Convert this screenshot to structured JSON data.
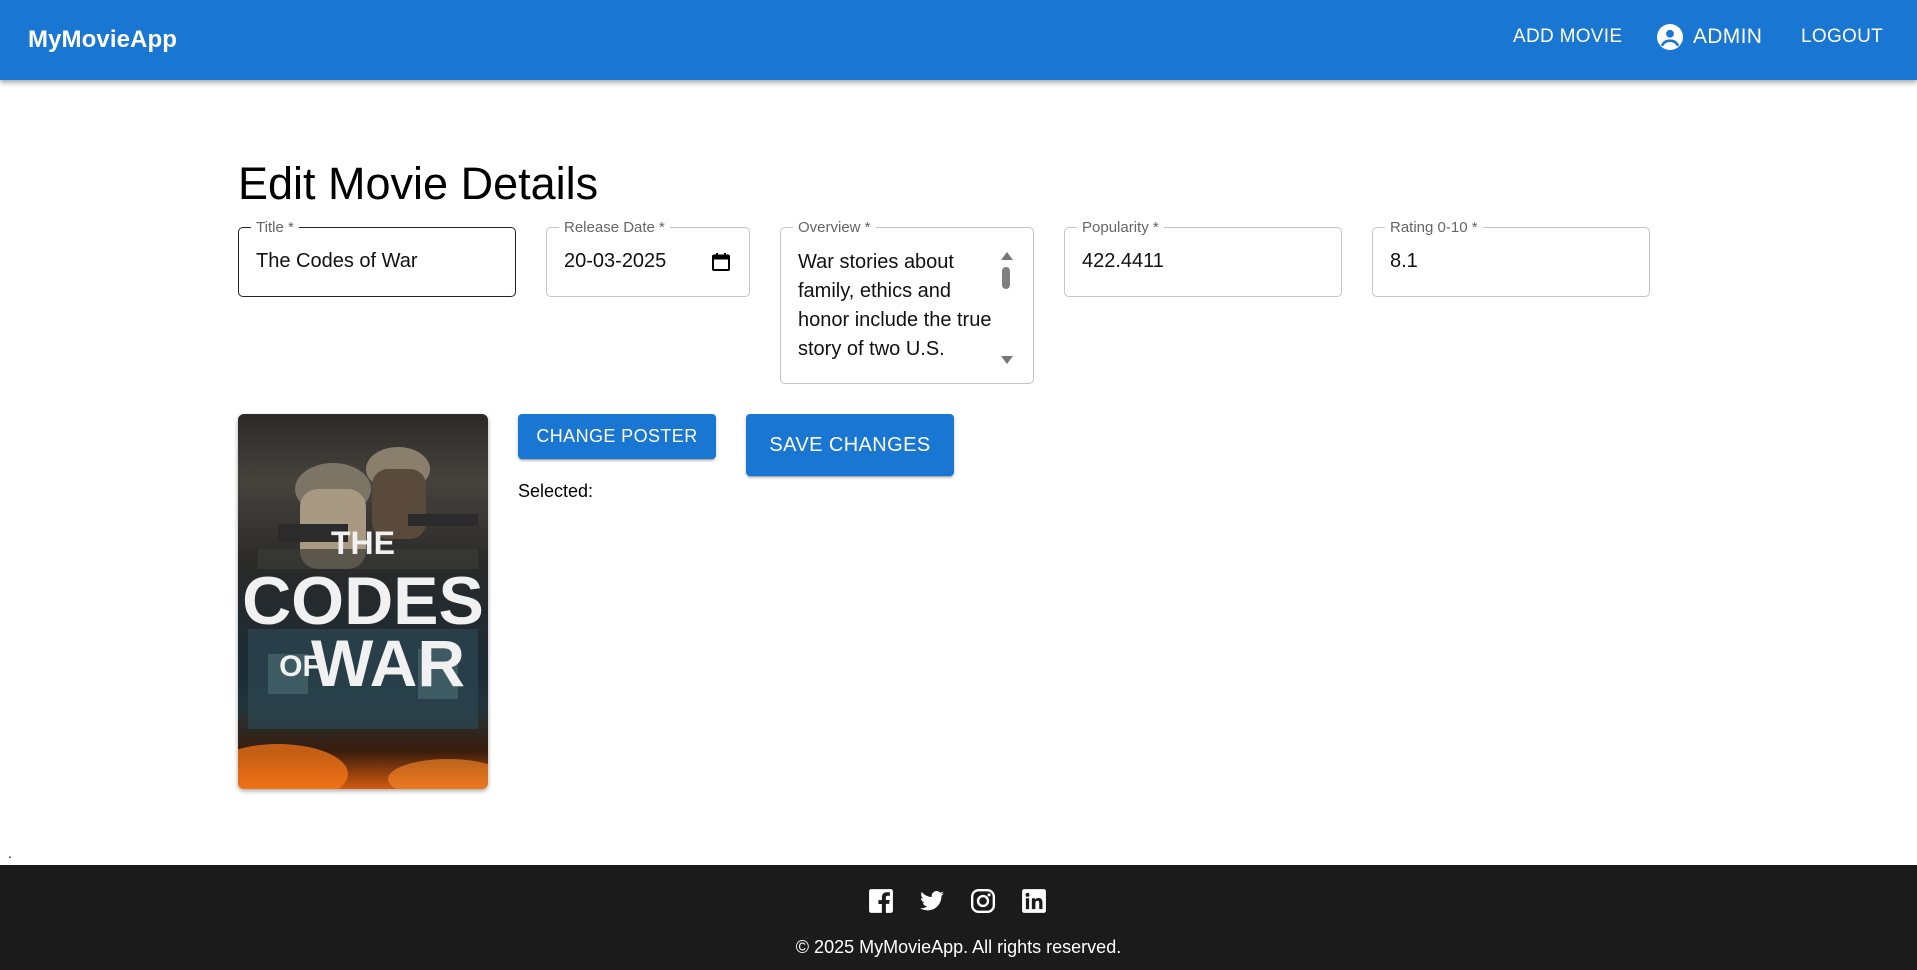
{
  "header": {
    "brand": "MyMovieApp",
    "add_movie": "ADD MOVIE",
    "admin": "ADMIN",
    "logout": "LOGOUT",
    "bg_color": "#1976d2"
  },
  "page": {
    "title": "Edit Movie Details"
  },
  "form": {
    "title": {
      "label": "Title *",
      "value": "The Codes of War"
    },
    "release_date": {
      "label": "Release Date *",
      "value": "20-03-2025"
    },
    "overview": {
      "label": "Overview *",
      "value": "War stories about family, ethics and honor include the true story of two U.S."
    },
    "popularity": {
      "label": "Popularity *",
      "value": "422.4411"
    },
    "rating": {
      "label": "Rating 0-10 *",
      "value": "8.1"
    }
  },
  "poster": {
    "text_line1": "THE",
    "text_line2": "CODES",
    "text_line3": "OF",
    "text_line4": "WAR"
  },
  "actions": {
    "change_poster": "CHANGE POSTER",
    "save_changes": "SAVE CHANGES",
    "selected_label": "Selected:"
  },
  "misc": {
    "dot": "."
  },
  "footer": {
    "icons": [
      "facebook-icon",
      "twitter-icon",
      "instagram-icon",
      "linkedin-icon"
    ],
    "copyright": "© 2025 MyMovieApp. All rights reserved.",
    "bg_color": "#1b1b1b"
  }
}
